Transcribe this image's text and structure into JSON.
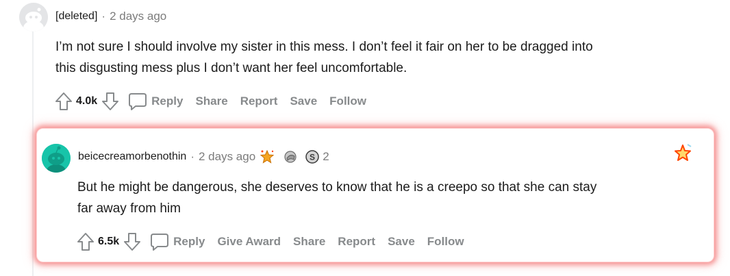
{
  "parent": {
    "author": "[deleted]",
    "separator": "·",
    "time": "2 days ago",
    "body_line1": "I’m not sure I should involve my sister in this mess. I don’t feel it fair on her to be dragged into",
    "body_line2": "this disgusting mess plus I don’t want her feel uncomfortable.",
    "score": "4.0k",
    "actions": [
      "Reply",
      "Share",
      "Report",
      "Save",
      "Follow"
    ]
  },
  "reply": {
    "author": "beicecreamorbenothin",
    "separator": "·",
    "time": "2 days ago",
    "awards": [
      "starstruck-award-icon",
      "facepalm-award-icon",
      "silver-award-icon"
    ],
    "award_count": "2",
    "body_line1": "But he might be dangerous, she deserves to know that he is a creepo so that she can stay",
    "body_line2": "far away from him",
    "score": "6.5k",
    "actions": [
      "Reply",
      "Give Award",
      "Share",
      "Report",
      "Save",
      "Follow"
    ]
  },
  "colors": {
    "highlight_glow": "#f05a5a",
    "action_gray": "#878a8c",
    "snoo_teal": "#17c4a9",
    "award_gold": "#f5a623"
  }
}
